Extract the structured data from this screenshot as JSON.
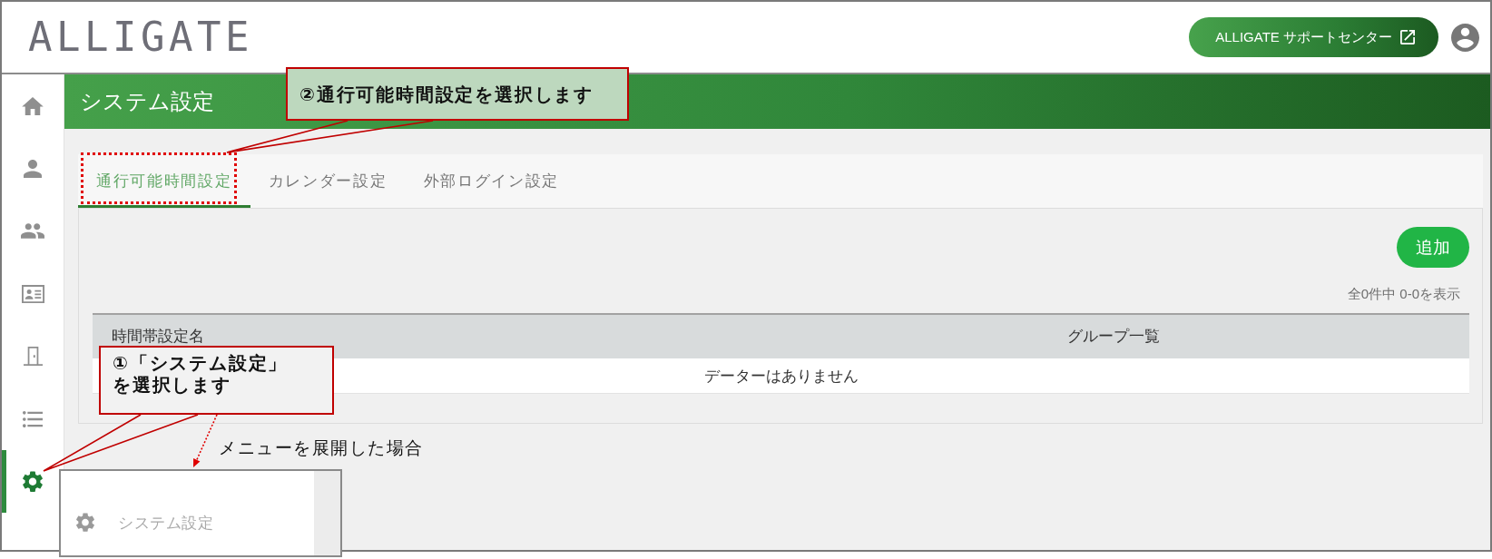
{
  "header": {
    "logo": "ALLIGATE",
    "support_button": "ALLIGATE サポートセンター"
  },
  "sidebar": {
    "items": [
      {
        "selected": false
      },
      {
        "selected": false
      },
      {
        "selected": false
      },
      {
        "selected": false
      },
      {
        "selected": false
      },
      {
        "selected": false
      },
      {
        "selected": true
      }
    ]
  },
  "page_title": "システム設定",
  "tabs": [
    {
      "label": "通行可能時間設定",
      "selected": true
    },
    {
      "label": "カレンダー設定",
      "selected": false
    },
    {
      "label": "外部ログイン設定",
      "selected": false
    }
  ],
  "panel": {
    "add_button": "追加",
    "count": "全0件中 0-0を表示",
    "table": {
      "columns": [
        "時間帯設定名",
        "グループ一覧"
      ],
      "empty_message": "データーはありません"
    }
  },
  "expanded_menu": {
    "caption": "メニューを展開した場合",
    "items": [
      {
        "label": "システム設定"
      }
    ]
  },
  "callouts": [
    {
      "text": "②通行可能時間設定を選択します"
    },
    {
      "text": "①「システム設定」を選択します"
    }
  ]
}
